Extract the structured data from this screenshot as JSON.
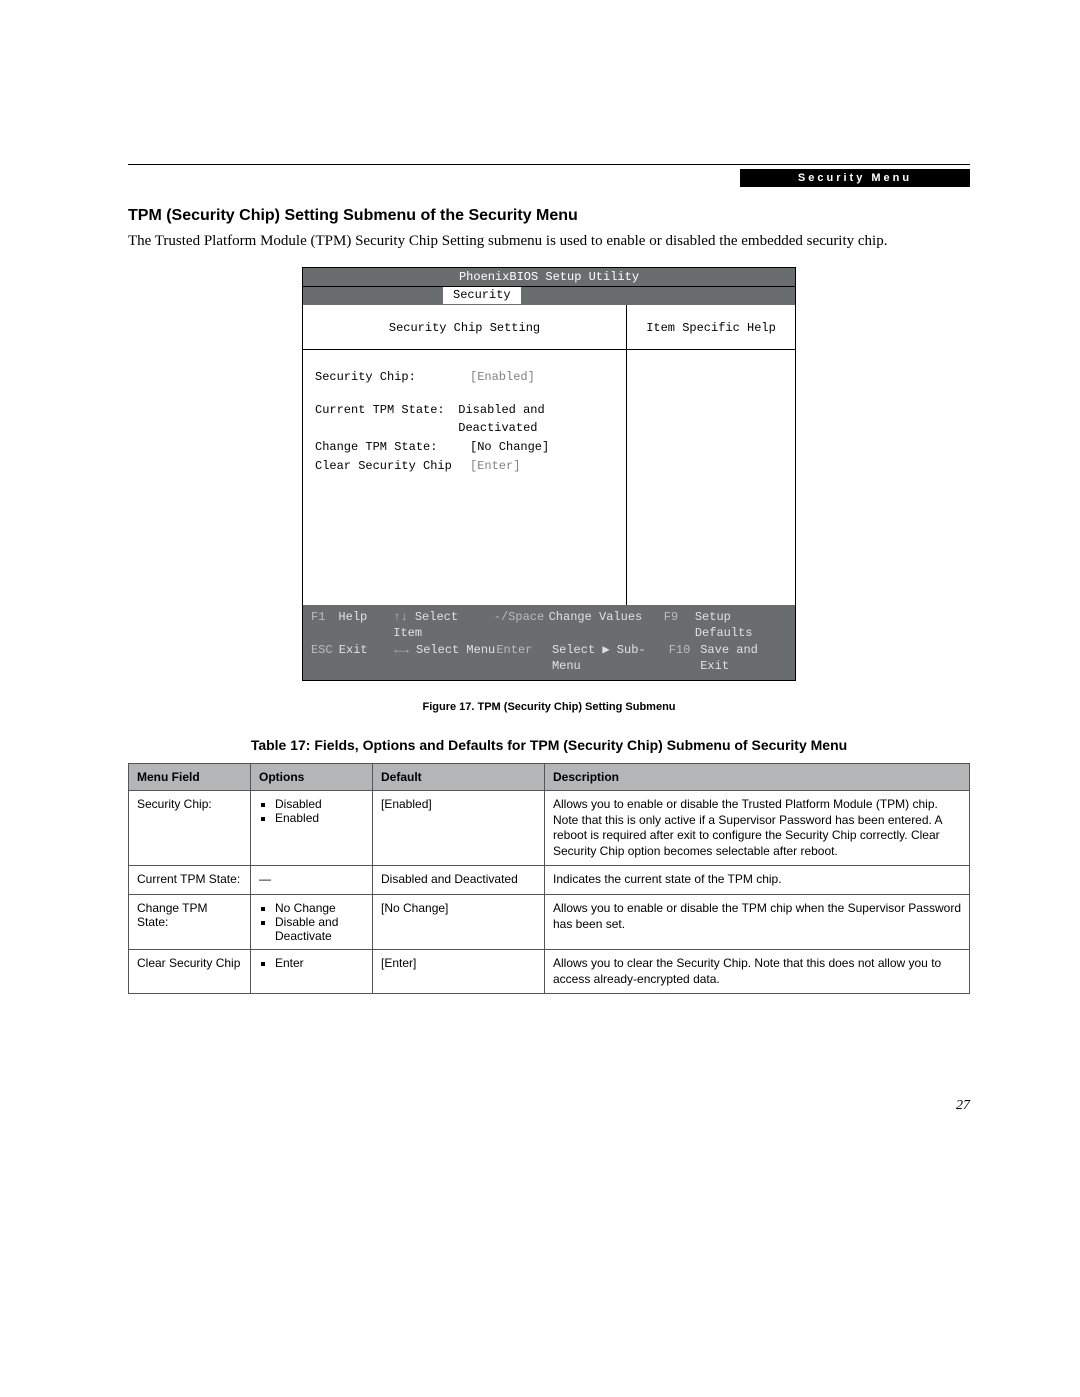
{
  "header_badge": "Security Menu",
  "section_title": "TPM (Security Chip) Setting Submenu of the Security Menu",
  "intro_text": "The Trusted Platform Module (TPM) Security Chip Setting submenu is used to enable or disabled the embedded security chip.",
  "bios": {
    "app_title": "PhoenixBIOS Setup Utility",
    "tab": "Security",
    "left_heading": "Security Chip Setting",
    "right_heading": "Item Specific Help",
    "fields": {
      "security_chip_label": "Security Chip:",
      "security_chip_value": "[Enabled]",
      "current_state_label": "Current TPM State:",
      "current_state_value": "Disabled and Deactivated",
      "change_state_label": "Change TPM State:",
      "change_state_value": "[No Change]",
      "clear_label": "Clear Security Chip",
      "clear_value": "[Enter]"
    },
    "footer": {
      "f1": "F1",
      "help": "Help",
      "arrows_ud": "↑↓",
      "select_item": "Select Item",
      "minus_space": "-/Space",
      "change_values": "Change Values",
      "f9": "F9",
      "setup_defaults": "Setup Defaults",
      "esc": "ESC",
      "exit": "Exit",
      "arrows_lr": "←→",
      "select_menu": "Select Menu",
      "enter": "Enter",
      "select_submenu": "Select ▶ Sub-Menu",
      "f10": "F10",
      "save_exit": "Save and Exit"
    }
  },
  "figure_caption": "Figure 17.  TPM (Security Chip) Setting Submenu",
  "table_caption": "Table 17: Fields, Options and Defaults for TPM (Security Chip) Submenu of Security Menu",
  "table": {
    "headers": {
      "field": "Menu Field",
      "options": "Options",
      "default": "Default",
      "description": "Description"
    },
    "rows": [
      {
        "field": "Security Chip:",
        "options": [
          "Disabled",
          "Enabled"
        ],
        "default": "[Enabled]",
        "description": "Allows you to enable or disable the Trusted Platform Module (TPM) chip. Note that this is only active if a Supervisor Password has been entered. A reboot is required after exit to configure the Security Chip correctly. Clear Security Chip option becomes selectable after reboot."
      },
      {
        "field": "Current TPM State:",
        "options_text": "—",
        "default": "Disabled and Deactivated",
        "description": "Indicates the current state of the TPM chip."
      },
      {
        "field": "Change TPM State:",
        "options": [
          "No Change",
          "Disable and Deactivate"
        ],
        "default": "[No Change]",
        "description": "Allows you to enable or disable the TPM chip when the Supervisor Password has been set."
      },
      {
        "field": "Clear Security Chip",
        "options": [
          "Enter"
        ],
        "default": "[Enter]",
        "description": "Allows you to clear the Security Chip. Note that this does not allow you to access already-encrypted data."
      }
    ]
  },
  "page_number": "27"
}
